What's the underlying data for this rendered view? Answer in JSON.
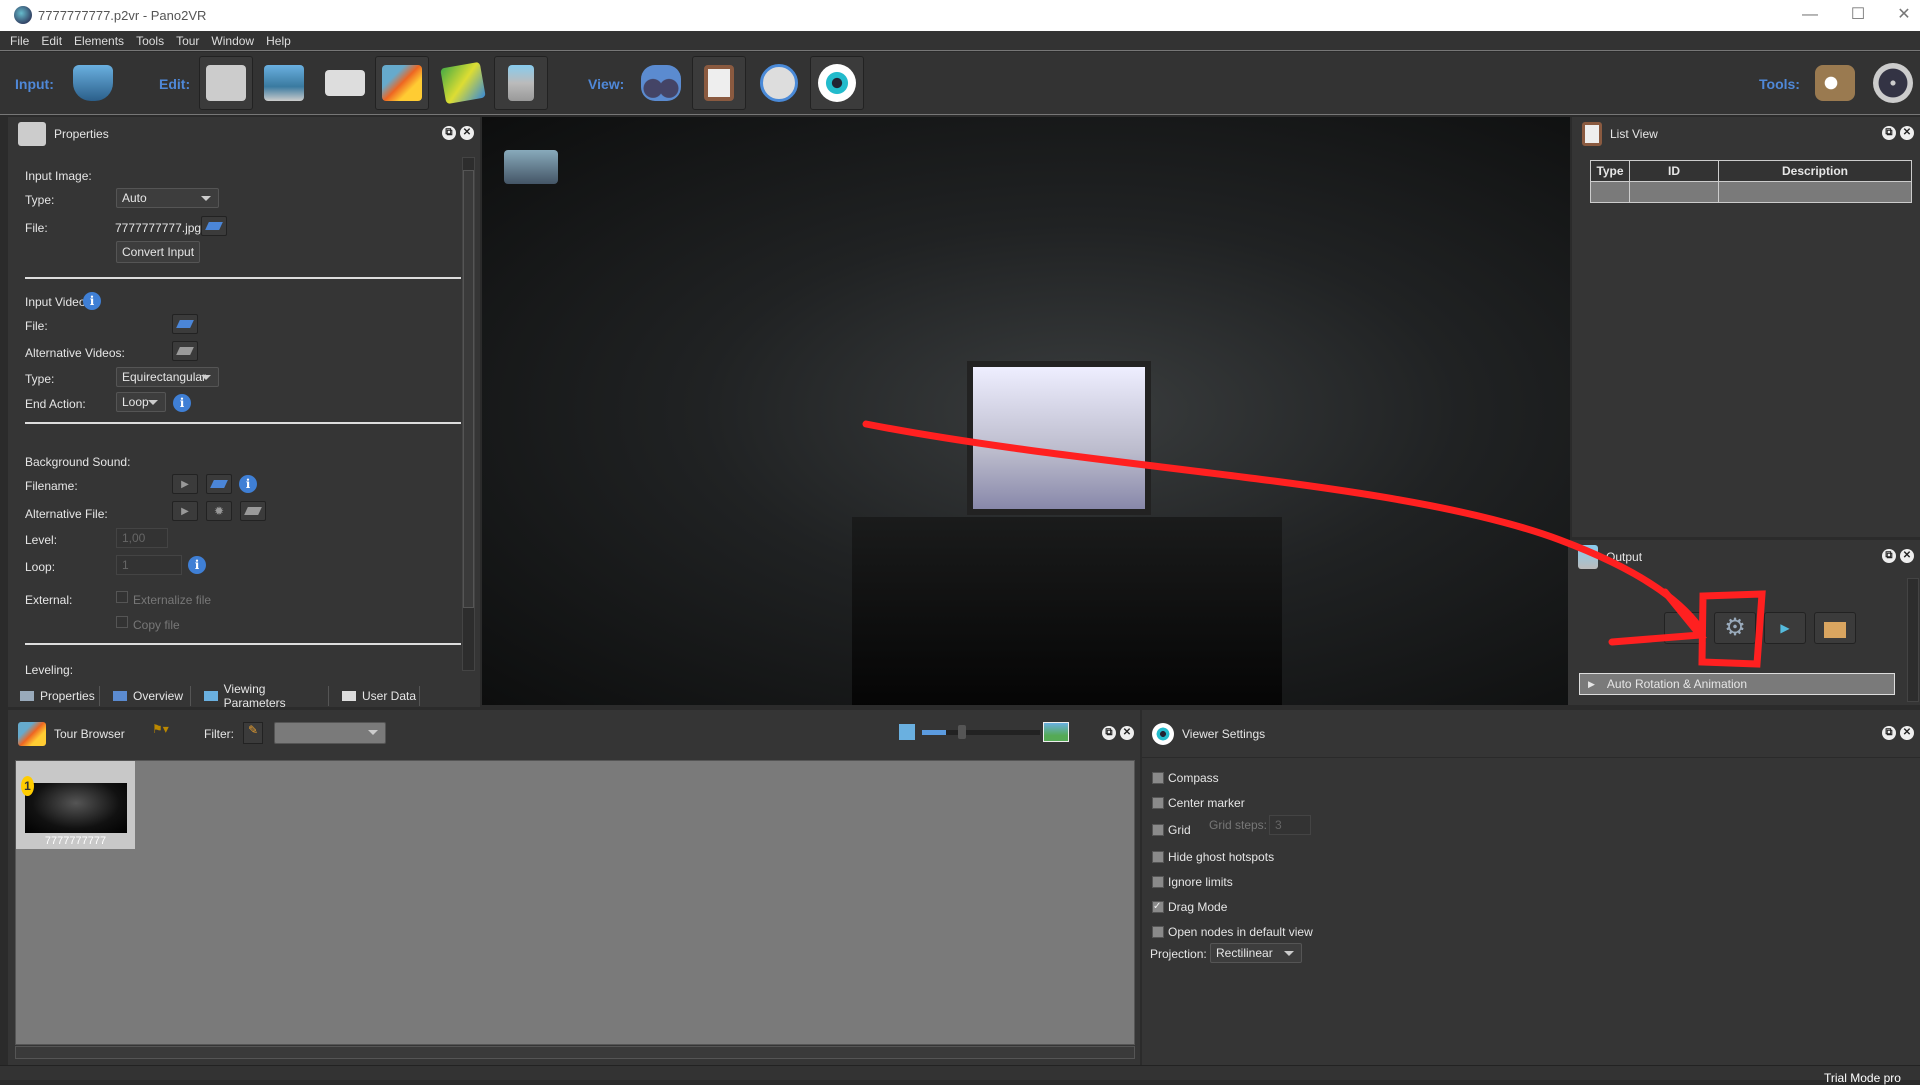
{
  "window": {
    "title": "7777777777.p2vr - Pano2VR",
    "minimize": "—",
    "maximize": "☐",
    "close": "✕"
  },
  "menu": [
    "File",
    "Edit",
    "Elements",
    "Tools",
    "Tour",
    "Window",
    "Help"
  ],
  "toolbar": {
    "input_label": "Input:",
    "edit_label": "Edit:",
    "view_label": "View:",
    "tools_label": "Tools:",
    "input_icons": [
      "import-panorama-icon"
    ],
    "edit_icons": [
      "properties-icon",
      "viewing-parameters-icon",
      "user-data-icon",
      "tour-browser-icon",
      "tour-map-icon",
      "output-icon"
    ],
    "view_icons": [
      "overview-icon",
      "list-view-icon",
      "animation-icon",
      "viewer-settings-icon"
    ],
    "tools_icons": [
      "skin-editor-icon",
      "movie-output-icon"
    ]
  },
  "properties": {
    "title": "Properties",
    "input_image": {
      "heading": "Input Image:",
      "type_label": "Type:",
      "type_value": "Auto",
      "file_label": "File:",
      "file_value": "7777777777.jpg",
      "convert_button": "Convert Input"
    },
    "input_video": {
      "heading": "Input Video:",
      "file_label": "File:",
      "alt_label": "Alternative Videos:",
      "type_label": "Type:",
      "type_value": "Equirectangular",
      "end_label": "End Action:",
      "end_value": "Loop"
    },
    "background_sound": {
      "heading": "Background Sound:",
      "filename_label": "Filename:",
      "alt_label": "Alternative File:",
      "level_label": "Level:",
      "level_value": "1,00",
      "loop_label": "Loop:",
      "loop_value": "1",
      "external_label": "External:",
      "externalize": "Externalize file",
      "copy": "Copy file"
    },
    "leveling": "Leveling:",
    "tabs": [
      "Properties",
      "Overview",
      "Viewing Parameters",
      "User Data"
    ]
  },
  "list_view": {
    "title": "List View",
    "columns": [
      "Type",
      "ID",
      "Description"
    ]
  },
  "output": {
    "title": "Output",
    "section": "Auto Rotation & Animation"
  },
  "tour_browser": {
    "title": "Tour Browser",
    "filter_label": "Filter:",
    "filter_value": "",
    "nodes": [
      {
        "badge": "1",
        "name": "7777777777"
      }
    ],
    "zoom_slider": 0.2
  },
  "viewer_settings": {
    "title": "Viewer Settings",
    "options": [
      {
        "label": "Compass",
        "checked": false
      },
      {
        "label": "Center marker",
        "checked": false
      },
      {
        "label": "Grid",
        "checked": false
      },
      {
        "label": "Hide ghost hotspots",
        "checked": false
      },
      {
        "label": "Ignore limits",
        "checked": false
      },
      {
        "label": "Drag Mode",
        "checked": true
      },
      {
        "label": "Open nodes in default view",
        "checked": false
      }
    ],
    "grid_steps_label": "Grid steps:",
    "grid_steps_value": "3",
    "projection_label": "Projection:",
    "projection_value": "Rectilinear"
  },
  "status": {
    "text": "Trial Mode pro"
  },
  "colors": {
    "accent": "#4f88d8",
    "annotation": "#ff2020",
    "panel": "#353535"
  }
}
